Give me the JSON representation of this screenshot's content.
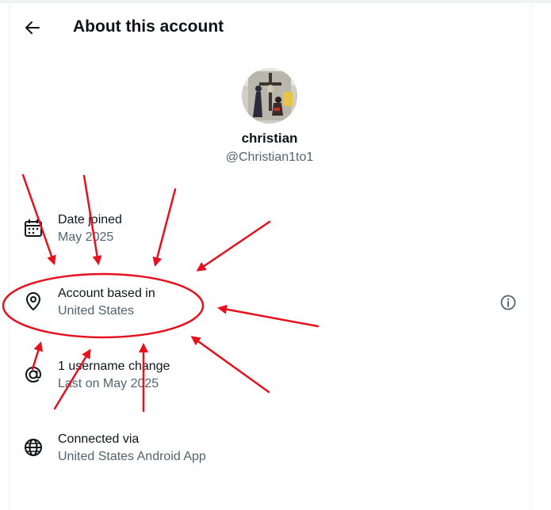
{
  "header": {
    "title": "About this account"
  },
  "profile": {
    "display_name": "christian",
    "handle": "@Christian1to1"
  },
  "rows": [
    {
      "label": "Date joined",
      "value": "May 2025",
      "icon": "calendar-icon"
    },
    {
      "label": "Account based in",
      "value": "United States",
      "icon": "location-pin-icon"
    },
    {
      "label": "1 username change",
      "value": "Last on May 2025",
      "icon": "at-sign-icon"
    },
    {
      "label": "Connected via",
      "value": "United States Android App",
      "icon": "globe-icon"
    }
  ],
  "colors": {
    "text_primary": "#0f1419",
    "text_secondary": "#536471",
    "annotation_red": "#e8101d",
    "border": "#eff3f4"
  }
}
